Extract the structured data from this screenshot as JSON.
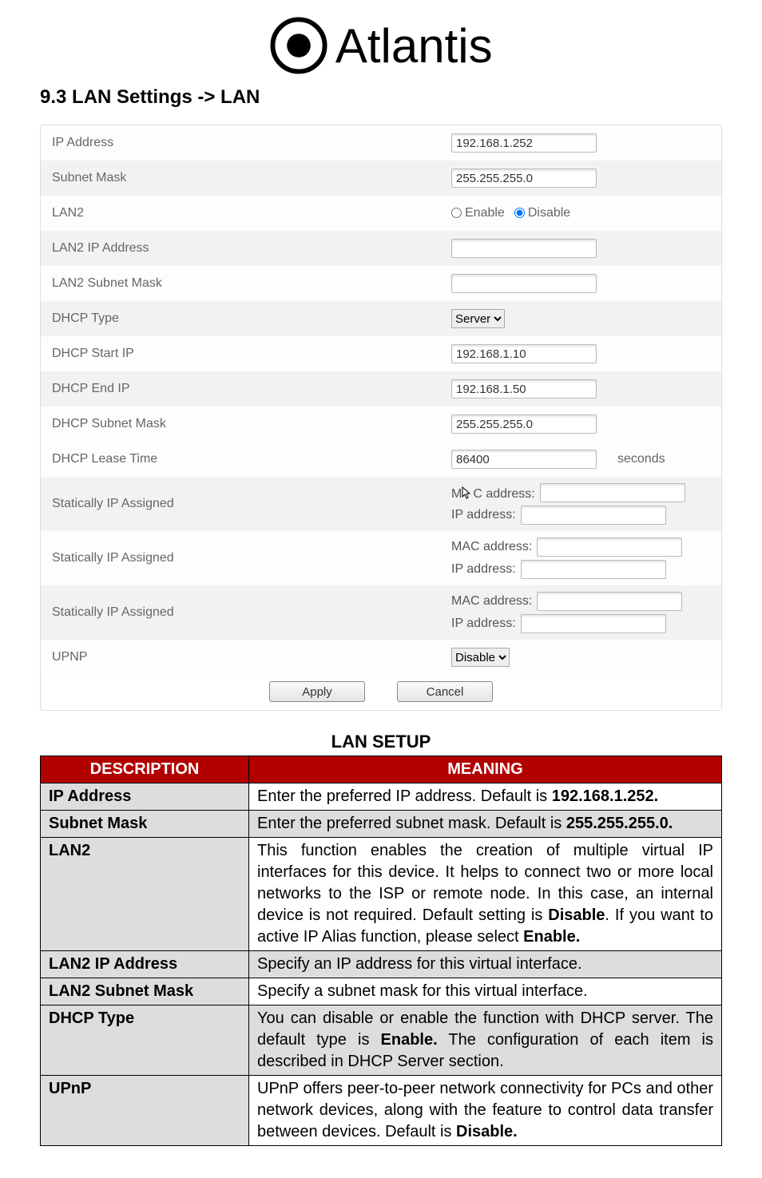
{
  "brand": "Atlantis",
  "section_heading": "9.3 LAN Settings -> LAN",
  "form": {
    "rows": [
      {
        "key": "ip_address",
        "label": "IP Address",
        "type": "text",
        "value": "192.168.1.252"
      },
      {
        "key": "subnet_mask",
        "label": "Subnet Mask",
        "type": "text",
        "value": "255.255.255.0"
      },
      {
        "key": "lan2",
        "label": "LAN2",
        "type": "radio",
        "options": [
          {
            "label": "Enable",
            "checked": false
          },
          {
            "label": "Disable",
            "checked": true
          }
        ]
      },
      {
        "key": "lan2_ip",
        "label": "LAN2 IP Address",
        "type": "text",
        "value": ""
      },
      {
        "key": "lan2_mask",
        "label": "LAN2 Subnet Mask",
        "type": "text",
        "value": ""
      },
      {
        "key": "dhcp_type",
        "label": "DHCP Type",
        "type": "select",
        "value": "Server"
      },
      {
        "key": "dhcp_start",
        "label": "DHCP Start IP",
        "type": "text",
        "value": "192.168.1.10"
      },
      {
        "key": "dhcp_end",
        "label": "DHCP End IP",
        "type": "text",
        "value": "192.168.1.50"
      },
      {
        "key": "dhcp_mask",
        "label": "DHCP Subnet Mask",
        "type": "text",
        "value": "255.255.255.0"
      },
      {
        "key": "dhcp_lease",
        "label": "DHCP Lease Time",
        "type": "text",
        "value": "86400",
        "after": "seconds"
      },
      {
        "key": "static1",
        "label": "Statically IP Assigned",
        "type": "macip",
        "mac_label_cursor": true,
        "mac_label": "MAC address:",
        "ip_label": "IP address:",
        "mac": "",
        "ip": ""
      },
      {
        "key": "static2",
        "label": "Statically IP Assigned",
        "type": "macip",
        "mac_label": "MAC address:",
        "ip_label": "IP address:",
        "mac": "",
        "ip": ""
      },
      {
        "key": "static3",
        "label": "Statically IP Assigned",
        "type": "macip",
        "mac_label": "MAC address:",
        "ip_label": "IP address:",
        "mac": "",
        "ip": ""
      },
      {
        "key": "upnp",
        "label": "UPNP",
        "type": "select",
        "value": "Disable"
      }
    ],
    "apply": "Apply",
    "cancel": "Cancel"
  },
  "lan_table": {
    "title": "LAN SETUP",
    "headers": {
      "desc": "DESCRIPTION",
      "meaning": "MEANING"
    },
    "rows": [
      {
        "desc": "IP Address",
        "meaning_pre": "Enter the preferred IP address. Default is ",
        "meaning_bold": "192.168.1.252.",
        "meaning_post": "",
        "shade": false
      },
      {
        "desc": "Subnet Mask",
        "meaning_pre": "Enter the preferred subnet mask. Default is ",
        "meaning_bold": "255.255.255.0.",
        "meaning_post": "",
        "shade": true
      },
      {
        "desc": "LAN2",
        "meaning_html": "This function enables the creation of multiple virtual IP interfaces for this device. It helps to connect two or more local networks to the ISP or remote node. In this case, an internal device is not required. Default setting is <span class='b'>Disable</span>. If you want to active IP Alias function, please select <span class='b'>Enable.</span>",
        "shade": false
      },
      {
        "desc": "LAN2 IP Address",
        "meaning_pre": "Specify an IP address for this virtual interface.",
        "meaning_bold": "",
        "meaning_post": "",
        "shade": true
      },
      {
        "desc": "LAN2 Subnet Mask",
        "meaning_pre": "Specify a subnet mask for this virtual interface.",
        "meaning_bold": "",
        "meaning_post": "",
        "shade": false
      },
      {
        "desc": "DHCP Type",
        "meaning_html": "You can disable or enable the function with DHCP server. The default type is <span class='b'>Enable.</span> The configuration of each item is described in DHCP Server section.",
        "shade": true
      },
      {
        "desc": "UPnP",
        "meaning_html": "UPnP offers peer-to-peer network connectivity for PCs and other network devices, along with the feature to control data transfer between devices. Default is <span class='b'>Disable.</span>",
        "shade": false
      }
    ]
  }
}
